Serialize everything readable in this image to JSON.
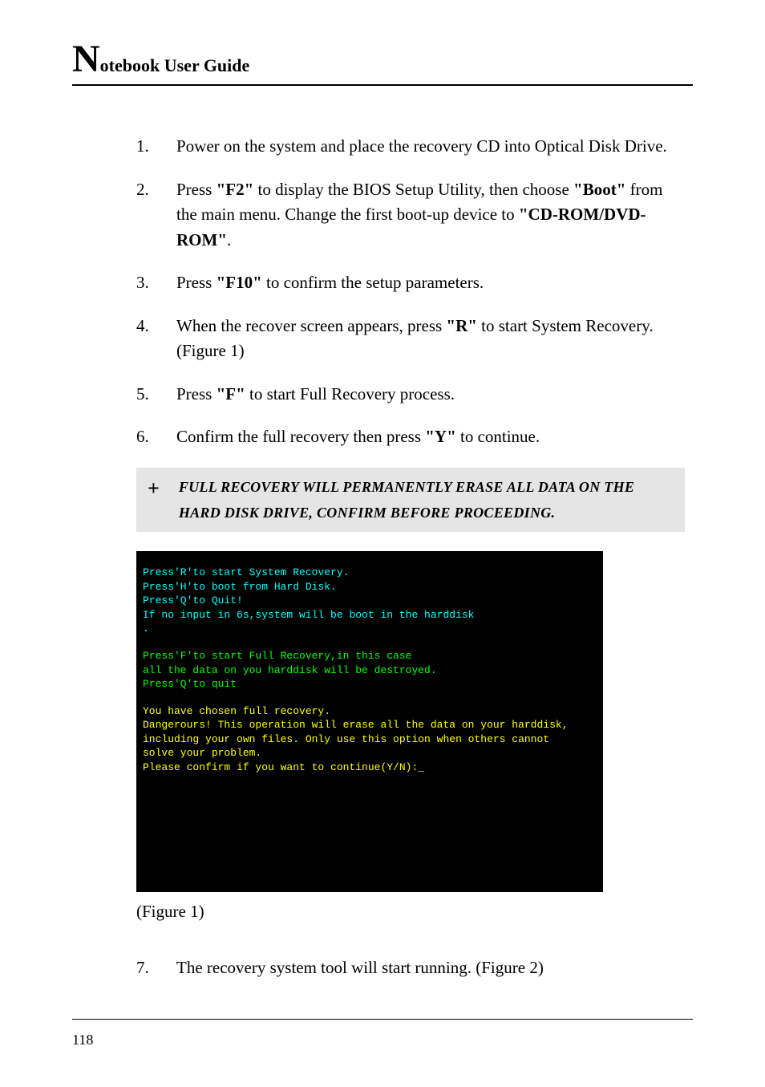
{
  "header": {
    "title_big": "N",
    "title_rest": "otebook User Guide"
  },
  "steps": [
    {
      "num": "1.",
      "parts": [
        {
          "t": "Power on the system and place the recovery CD into Optical Disk Drive."
        }
      ]
    },
    {
      "num": "2.",
      "parts": [
        {
          "t": "Press "
        },
        {
          "t": "\"F2\"",
          "b": true
        },
        {
          "t": " to display the BIOS Setup Utility, then choose "
        },
        {
          "t": "\"Boot\"",
          "b": true
        },
        {
          "t": " from the main menu.  Change the first boot-up device to "
        },
        {
          "t": "\"CD-ROM/DVD-ROM\"",
          "b": true
        },
        {
          "t": "."
        }
      ]
    },
    {
      "num": "3.",
      "parts": [
        {
          "t": "Press "
        },
        {
          "t": "\"F10\"",
          "b": true
        },
        {
          "t": " to confirm the setup parameters."
        }
      ]
    },
    {
      "num": "4.",
      "parts": [
        {
          "t": "When the recover screen appears, press "
        },
        {
          "t": "\"R\"",
          "b": true
        },
        {
          "t": " to start System Recovery. (Figure 1)"
        }
      ]
    },
    {
      "num": "5.",
      "parts": [
        {
          "t": "Press "
        },
        {
          "t": "\"F\"",
          "b": true
        },
        {
          "t": " to start Full Recovery process."
        }
      ]
    },
    {
      "num": "6.",
      "parts": [
        {
          "t": "Confirm the full recovery then press "
        },
        {
          "t": "\"Y\"",
          "b": true
        },
        {
          "t": " to continue."
        }
      ]
    }
  ],
  "warning": {
    "icon": "+",
    "text": "FULL RECOVERY WILL PERMANENTLY ERASE ALL DATA ON THE HARD DISK DRIVE, CONFIRM BEFORE PROCEEDING."
  },
  "terminal": {
    "block1": {
      "line1": "Press'R'to start System Recovery.",
      "line2": "Press'H'to boot from Hard Disk.",
      "line3": "Press'Q'to Quit!",
      "line4": "If no input in 6s,system will be boot in the harddisk",
      "line5": "."
    },
    "block2": {
      "line1": "Press'F'to start Full Recovery,in this case",
      "line2": "      all the data on you harddisk will be destroyed.",
      "line3": "Press'Q'to quit"
    },
    "block3": {
      "line1": "You have chosen full recovery.",
      "line2": "Dangerours! This operation will erase all the data on your harddisk,",
      "line3": "including your own files. Only use this option when others cannot",
      "line4": "solve your problem.",
      "line5": "Please confirm if you want to continue(Y/N):_"
    }
  },
  "figure_label": "(Figure 1)",
  "step7": {
    "num": "7.",
    "text": "The recovery system tool will start running. (Figure 2)"
  },
  "page_number": "118"
}
